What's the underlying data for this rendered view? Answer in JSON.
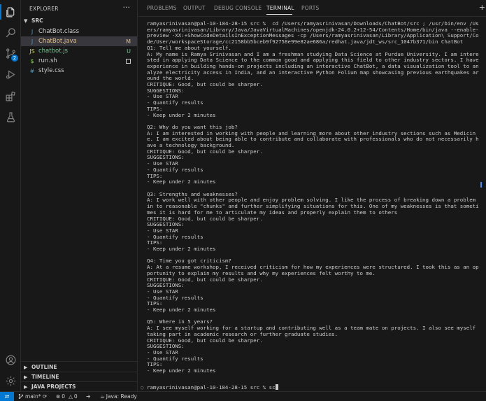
{
  "activity": {
    "scm_badge": "2"
  },
  "sidebar": {
    "header": "EXPLORER",
    "more": "···",
    "folder": "SRC",
    "files": [
      {
        "icon": "J",
        "name": "ChatBot.class",
        "status": "",
        "name_color": "#cccccc",
        "icon_color": "#519aba",
        "status_color": "#cccccc"
      },
      {
        "icon": "J",
        "name": "ChatBot.java",
        "status": "M",
        "name_color": "#e2c08d",
        "icon_color": "#519aba",
        "status_color": "#e2c08d"
      },
      {
        "icon": "JS",
        "name": "chatbot.js",
        "status": "U",
        "name_color": "#73c991",
        "icon_color": "#cbcb41",
        "status_color": "#73c991"
      },
      {
        "icon": "$",
        "name": "run.sh",
        "status": "",
        "name_color": "#cccccc",
        "icon_color": "#89e051",
        "status_color": "#cccccc"
      },
      {
        "icon": "#",
        "name": "style.css",
        "status": "",
        "name_color": "#cccccc",
        "icon_color": "#519aba",
        "status_color": "#cccccc"
      }
    ],
    "sections": [
      "OUTLINE",
      "TIMELINE",
      "JAVA PROJECTS"
    ]
  },
  "panel": {
    "tabs": [
      "PROBLEMS",
      "OUTPUT",
      "DEBUG CONSOLE",
      "TERMINAL",
      "PORTS"
    ],
    "active_tab": "TERMINAL",
    "terminal_output": "ramyasrinivasan@pal-10-184-28-15 src %  cd /Users/ramyasrinivasan/Downloads/ChatBot/src ; /usr/bin/env /Users/ramyasrinivasan/Library/Java/JavaVirtualMachines/openjdk-24.0.2+12-54/Contents/Home/bin/java --enable-preview -XX:+ShowCodeDetailsInExceptionMessages -cp /Users/ramyasrinivasan/Library/Application\\ Support/Code/User/workspaceStorage/cc2158bb5bceb9f92758e99e82ae686a/redhat.java/jdt_ws/src_1047b371/bin ChatBot\nQ1: Tell me about yourself.\nA: My name is Ramya Srinivasan and I am a freshman studying Data Science at Purdue University. I am interested in applying Data Science to the common good and applying this field to other industry sectors. I have experience in building hands-on projects including an interactive ChatBot, a data visualization tool to analyze electricity access in India, and an interactive Python Folium map showcasing previous earthquakes around the world.\nCRITIQUE: Good, but could be sharper.\nSUGGESTIONS:\n- Use STAR\n- Quantify results\nTIPS:\n- Keep under 2 minutes\n\nQ2: Why do you want this job?\nA: I am interested in working with people and learning more about other industry sections such as Medicine. I am excited about being able to contribute and collaborate with professionals who do not necessarily have a technology background.\nCRITIQUE: Good, but could be sharper.\nSUGGESTIONS:\n- Use STAR\n- Quantify results\nTIPS:\n- Keep under 2 minutes\n\nQ3: Strengths and weaknesses?\nA: I work well with other people and enjoy problem solving. I like the process of breaking down a problem in to reasonable \"chunks\" and further simplifying situations for this. One of my weaknesses is that sometimes it is hard for me to articulate my ideas and properly explain them to others\nCRITIQUE: Good, but could be sharper.\nSUGGESTIONS:\n- Use STAR\n- Quantify results\nTIPS:\n- Keep under 2 minutes\n\nQ4: Time you got criticism?\nA: At a resume workshop, I received criticism for how my experiences were structured. I took this as an opportunity to explain my results and why my experiences felt worthy to me.\nCRITIQUE: Good, but could be sharper.\nSUGGESTIONS:\n- Use STAR\n- Quantify results\nTIPS:\n- Keep under 2 minutes\n\nQ5: Where in 5 years?\nA: I see myself working for a startup and contributing well as a team mate on projects. I also see myself taking part in academic research or further graduate studies.\nCRITIQUE: Good, but could be sharper.\nSUGGESTIONS:\n- Use STAR\n- Quantify results\nTIPS:\n- Keep under 2 minutes",
    "prompt": "ramyasrinivasan@pal-10-184-28-15 src % ",
    "typed": "sc"
  },
  "statusbar": {
    "branch": "main*",
    "errors": "0",
    "warnings": "0",
    "java": "Java: Ready"
  },
  "colors": {
    "accent": "#0078d4",
    "modified": "#e2c08d",
    "untracked": "#73c991"
  }
}
